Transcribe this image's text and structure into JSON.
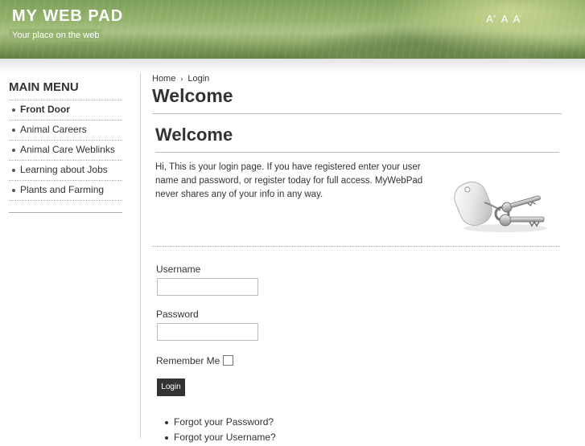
{
  "header": {
    "site_title": "MY WEB PAD",
    "tagline": "Your place on the web",
    "font_tools": [
      "A+",
      "A",
      "A-"
    ]
  },
  "sidebar": {
    "heading": "MAIN MENU",
    "items": [
      {
        "label": "Front Door",
        "active": true
      },
      {
        "label": "Animal Careers"
      },
      {
        "label": "Animal Care Weblinks"
      },
      {
        "label": "Learning about Jobs"
      },
      {
        "label": "Plants and Farming"
      }
    ]
  },
  "breadcrumb": {
    "home": "Home",
    "current": "Login"
  },
  "main": {
    "page_title": "Welcome",
    "component_title": "Welcome",
    "intro": "Hi, This is your login page. If you have registered enter your user name and password, or register today for full access. MyWebPad never shares any of your info in any way.",
    "image_icon": "keys-icon"
  },
  "form": {
    "username_label": "Username",
    "username_value": "",
    "password_label": "Password",
    "password_value": "",
    "remember_label": "Remember Me",
    "login_button": "Login"
  },
  "links": {
    "forgot_password": "Forgot your Password?",
    "forgot_username": "Forgot your Username?"
  },
  "colors": {
    "header_green": "#94b36d",
    "button_dark": "#333333"
  }
}
